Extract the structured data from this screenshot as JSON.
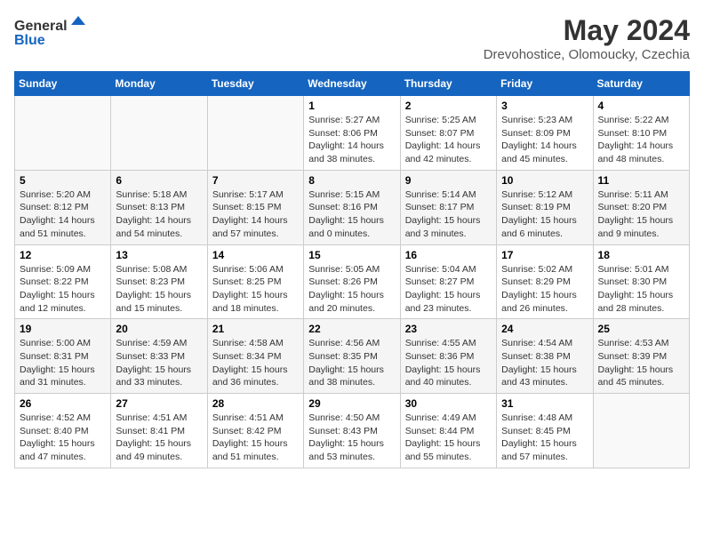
{
  "header": {
    "logo_general": "General",
    "logo_blue": "Blue",
    "title": "May 2024",
    "subtitle": "Drevohostice, Olomoucky, Czechia"
  },
  "calendar": {
    "days_of_week": [
      "Sunday",
      "Monday",
      "Tuesday",
      "Wednesday",
      "Thursday",
      "Friday",
      "Saturday"
    ],
    "weeks": [
      [
        {
          "day": "",
          "info": ""
        },
        {
          "day": "",
          "info": ""
        },
        {
          "day": "",
          "info": ""
        },
        {
          "day": "1",
          "info": "Sunrise: 5:27 AM\nSunset: 8:06 PM\nDaylight: 14 hours and 38 minutes."
        },
        {
          "day": "2",
          "info": "Sunrise: 5:25 AM\nSunset: 8:07 PM\nDaylight: 14 hours and 42 minutes."
        },
        {
          "day": "3",
          "info": "Sunrise: 5:23 AM\nSunset: 8:09 PM\nDaylight: 14 hours and 45 minutes."
        },
        {
          "day": "4",
          "info": "Sunrise: 5:22 AM\nSunset: 8:10 PM\nDaylight: 14 hours and 48 minutes."
        }
      ],
      [
        {
          "day": "5",
          "info": "Sunrise: 5:20 AM\nSunset: 8:12 PM\nDaylight: 14 hours and 51 minutes."
        },
        {
          "day": "6",
          "info": "Sunrise: 5:18 AM\nSunset: 8:13 PM\nDaylight: 14 hours and 54 minutes."
        },
        {
          "day": "7",
          "info": "Sunrise: 5:17 AM\nSunset: 8:15 PM\nDaylight: 14 hours and 57 minutes."
        },
        {
          "day": "8",
          "info": "Sunrise: 5:15 AM\nSunset: 8:16 PM\nDaylight: 15 hours and 0 minutes."
        },
        {
          "day": "9",
          "info": "Sunrise: 5:14 AM\nSunset: 8:17 PM\nDaylight: 15 hours and 3 minutes."
        },
        {
          "day": "10",
          "info": "Sunrise: 5:12 AM\nSunset: 8:19 PM\nDaylight: 15 hours and 6 minutes."
        },
        {
          "day": "11",
          "info": "Sunrise: 5:11 AM\nSunset: 8:20 PM\nDaylight: 15 hours and 9 minutes."
        }
      ],
      [
        {
          "day": "12",
          "info": "Sunrise: 5:09 AM\nSunset: 8:22 PM\nDaylight: 15 hours and 12 minutes."
        },
        {
          "day": "13",
          "info": "Sunrise: 5:08 AM\nSunset: 8:23 PM\nDaylight: 15 hours and 15 minutes."
        },
        {
          "day": "14",
          "info": "Sunrise: 5:06 AM\nSunset: 8:25 PM\nDaylight: 15 hours and 18 minutes."
        },
        {
          "day": "15",
          "info": "Sunrise: 5:05 AM\nSunset: 8:26 PM\nDaylight: 15 hours and 20 minutes."
        },
        {
          "day": "16",
          "info": "Sunrise: 5:04 AM\nSunset: 8:27 PM\nDaylight: 15 hours and 23 minutes."
        },
        {
          "day": "17",
          "info": "Sunrise: 5:02 AM\nSunset: 8:29 PM\nDaylight: 15 hours and 26 minutes."
        },
        {
          "day": "18",
          "info": "Sunrise: 5:01 AM\nSunset: 8:30 PM\nDaylight: 15 hours and 28 minutes."
        }
      ],
      [
        {
          "day": "19",
          "info": "Sunrise: 5:00 AM\nSunset: 8:31 PM\nDaylight: 15 hours and 31 minutes."
        },
        {
          "day": "20",
          "info": "Sunrise: 4:59 AM\nSunset: 8:33 PM\nDaylight: 15 hours and 33 minutes."
        },
        {
          "day": "21",
          "info": "Sunrise: 4:58 AM\nSunset: 8:34 PM\nDaylight: 15 hours and 36 minutes."
        },
        {
          "day": "22",
          "info": "Sunrise: 4:56 AM\nSunset: 8:35 PM\nDaylight: 15 hours and 38 minutes."
        },
        {
          "day": "23",
          "info": "Sunrise: 4:55 AM\nSunset: 8:36 PM\nDaylight: 15 hours and 40 minutes."
        },
        {
          "day": "24",
          "info": "Sunrise: 4:54 AM\nSunset: 8:38 PM\nDaylight: 15 hours and 43 minutes."
        },
        {
          "day": "25",
          "info": "Sunrise: 4:53 AM\nSunset: 8:39 PM\nDaylight: 15 hours and 45 minutes."
        }
      ],
      [
        {
          "day": "26",
          "info": "Sunrise: 4:52 AM\nSunset: 8:40 PM\nDaylight: 15 hours and 47 minutes."
        },
        {
          "day": "27",
          "info": "Sunrise: 4:51 AM\nSunset: 8:41 PM\nDaylight: 15 hours and 49 minutes."
        },
        {
          "day": "28",
          "info": "Sunrise: 4:51 AM\nSunset: 8:42 PM\nDaylight: 15 hours and 51 minutes."
        },
        {
          "day": "29",
          "info": "Sunrise: 4:50 AM\nSunset: 8:43 PM\nDaylight: 15 hours and 53 minutes."
        },
        {
          "day": "30",
          "info": "Sunrise: 4:49 AM\nSunset: 8:44 PM\nDaylight: 15 hours and 55 minutes."
        },
        {
          "day": "31",
          "info": "Sunrise: 4:48 AM\nSunset: 8:45 PM\nDaylight: 15 hours and 57 minutes."
        },
        {
          "day": "",
          "info": ""
        }
      ]
    ]
  }
}
